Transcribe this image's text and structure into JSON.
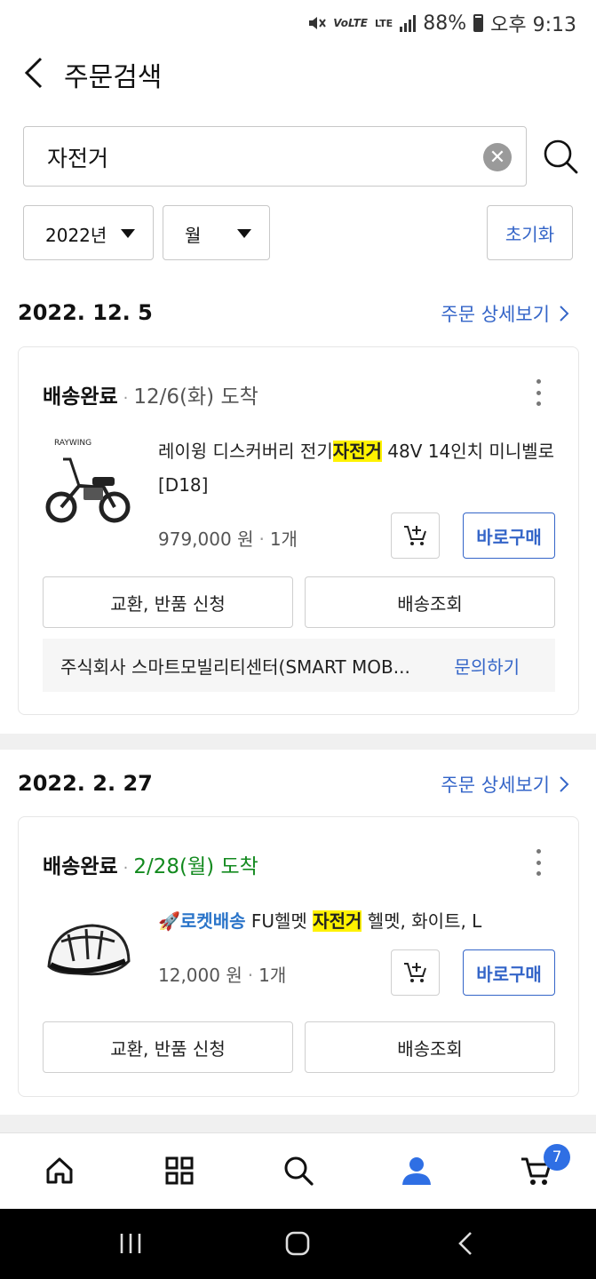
{
  "status_bar": {
    "battery": "88%",
    "time": "오후 9:13",
    "lte_label": "LTE"
  },
  "header": {
    "title": "주문검색"
  },
  "search": {
    "value": "자전거"
  },
  "filters": {
    "year": "2022년",
    "month": "월",
    "reset": "초기화"
  },
  "orders": [
    {
      "date": "2022. 12. 5",
      "detail_link": "주문 상세보기",
      "status": "배송완료",
      "eta": "12/6(화) 도착",
      "product": {
        "name_before": "레이윙 디스커버리 전기",
        "name_highlight": "자전거",
        "name_after": " 48V 14인치 미니벨로[D18]",
        "price": "979,000 원",
        "qty": "1개"
      },
      "buy_now": "바로구매",
      "exchange_return": "교환, 반품 신청",
      "track_delivery": "배송조회",
      "seller": "주식회사 스마트모빌리티센터(SMART MOB...",
      "inquiry": "문의하기"
    },
    {
      "date": "2022. 2. 27",
      "detail_link": "주문 상세보기",
      "status": "배송완료",
      "eta": "2/28(월) 도착",
      "product": {
        "rocket_label": "로켓배송",
        "name_before": " FU헬멧 ",
        "name_highlight": "자전거",
        "name_after": " 헬멧, 화이트, L",
        "price": "12,000 원",
        "qty": "1개"
      },
      "buy_now": "바로구매",
      "exchange_return": "교환, 반품 신청",
      "track_delivery": "배송조회"
    }
  ],
  "bottom_nav": {
    "items": [
      "home-icon",
      "categories-icon",
      "search-icon",
      "my-page-icon",
      "cart-icon"
    ],
    "cart_badge": "7",
    "active_color": "#2f6fe4"
  },
  "colors": {
    "link_blue": "#3465c8",
    "arrival_green": "#138a1f",
    "highlight": "#fff200"
  }
}
